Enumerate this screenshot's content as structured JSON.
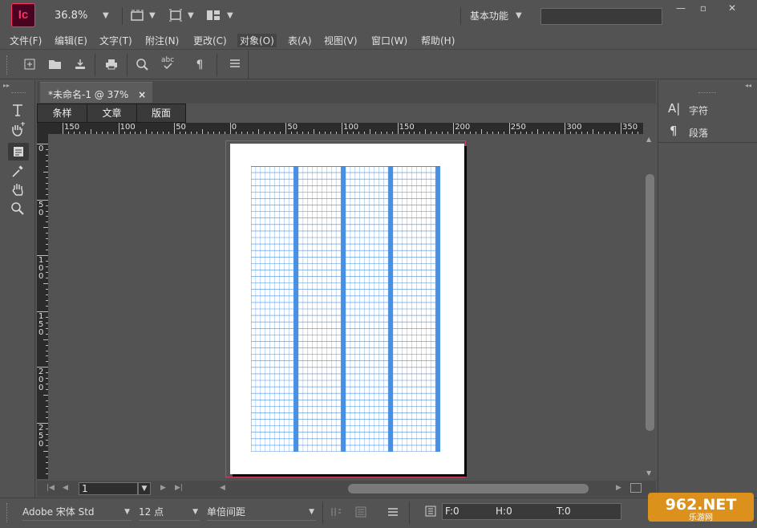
{
  "app": {
    "logo": "Ic",
    "zoom": "36.8%",
    "workspace": "基本功能"
  },
  "colors": {
    "brand": "#ff3366",
    "brand_bg": "#49021f",
    "bleed_guide": "#d04060",
    "grid_cell": "#4a90e2"
  },
  "icons": [
    "chevron-down-icon",
    "frame-edges-icon",
    "screen-mode-icon",
    "arrange-icon",
    "minimize-icon",
    "maximize-icon",
    "close-icon",
    "new-document-icon",
    "open-icon",
    "save-icon",
    "print-icon",
    "search-icon",
    "spellcheck-icon",
    "pilcrow-icon",
    "menu-icon",
    "type-tool-icon",
    "hand-tool-icon",
    "note-icon",
    "eyedropper-icon",
    "hand-icon",
    "zoom-icon",
    "character-icon",
    "paragraph-icon",
    "first-page-icon",
    "previous-page-icon",
    "next-page-icon",
    "last-page-icon"
  ],
  "window": {
    "minimize": "—",
    "maximize": "▫",
    "close": "✕"
  },
  "menu": [
    {
      "label": "文件(F)"
    },
    {
      "label": "编辑(E)"
    },
    {
      "label": "文字(T)"
    },
    {
      "label": "附注(N)"
    },
    {
      "label": "更改(C)"
    },
    {
      "label": "对象(O)"
    },
    {
      "label": "表(A)"
    },
    {
      "label": "视图(V)"
    },
    {
      "label": "窗口(W)"
    },
    {
      "label": "帮助(H)"
    }
  ],
  "document": {
    "tab_title": "*未命名-1 @ 37%",
    "close": "×"
  },
  "view_tabs": [
    {
      "label": "条样"
    },
    {
      "label": "文章"
    },
    {
      "label": "版面"
    }
  ],
  "ruler": {
    "h_labels": [
      "150",
      "100",
      "50",
      "0",
      "50",
      "100",
      "150",
      "200",
      "250",
      "300",
      "350"
    ],
    "v_labels": [
      "0",
      "5\n0",
      "1\n0\n0",
      "1\n5\n0",
      "2\n0\n0",
      "2\n5\n0"
    ]
  },
  "right_panel": {
    "items": [
      {
        "label": "字符"
      },
      {
        "label": "段落"
      }
    ]
  },
  "pager": {
    "page": "1"
  },
  "bottom": {
    "font": "Adobe 宋体 Std",
    "size": "12 点",
    "spacing": "单倍间距",
    "f_label": "F:0",
    "h_label": "H:0",
    "t_label": "T:0"
  },
  "watermark": {
    "brand": "962.NET",
    "sub": "乐游网"
  }
}
